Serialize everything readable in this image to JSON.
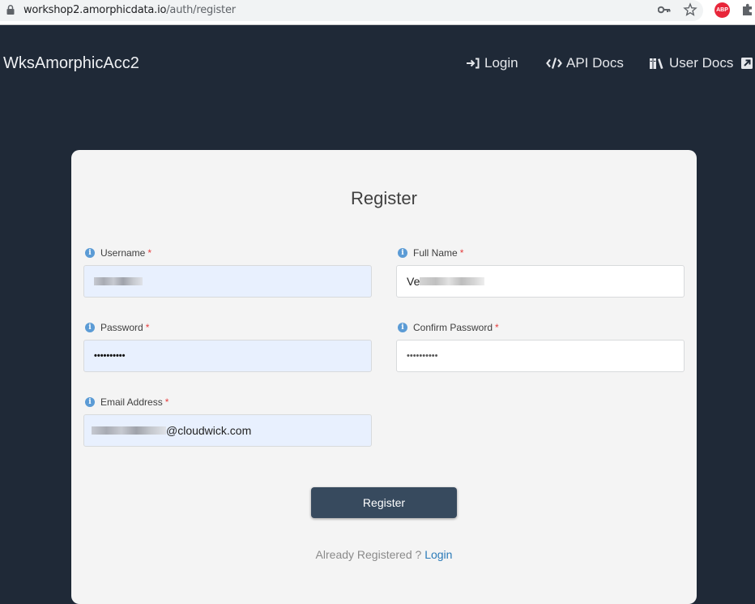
{
  "browser": {
    "url_host": "workshop2.amorphicdata.io",
    "url_path": "/auth/register",
    "extensions": [
      {
        "name": "password-key-icon"
      },
      {
        "name": "bookmark-star-icon"
      },
      {
        "name": "adblock-plus-icon",
        "label": "ABP"
      },
      {
        "name": "extensions-puzzle-icon"
      }
    ]
  },
  "navbar": {
    "brand": "WksAmorphicAcc2",
    "items": [
      {
        "label": "Login",
        "icon": "sign-in-icon"
      },
      {
        "label": "API Docs",
        "icon": "code-icon"
      },
      {
        "label": "User Docs",
        "icon": "books-icon",
        "trailing_icon": "external-link-icon"
      }
    ]
  },
  "form": {
    "title": "Register",
    "required_marker": "*",
    "info_glyph": "i",
    "fields": {
      "username": {
        "label": "Username",
        "value": "[redacted]",
        "autofilled": true
      },
      "full_name": {
        "label": "Full Name",
        "value_prefix": "Ve",
        "value": "Ve[redacted]",
        "autofilled": false
      },
      "password": {
        "label": "Password",
        "value": "••••••••••",
        "autofilled": true
      },
      "confirm_password": {
        "label": "Confirm Password",
        "value": "••••••••••",
        "autofilled": false
      },
      "email": {
        "label": "Email Address",
        "value_suffix": "@cloudwick.com",
        "value": "[redacted]@cloudwick.com",
        "autofilled": true
      }
    },
    "submit_label": "Register",
    "footer_text": "Already Registered ?",
    "footer_link": "Login"
  },
  "colors": {
    "navbar_bg": "#1f2937",
    "card_bg": "#f4f4f4",
    "button_bg": "#374a5e",
    "link": "#2a7ab8",
    "required": "#e53e3e",
    "info_icon": "#5b9bd5",
    "autofill_bg": "#e8f0fe"
  }
}
